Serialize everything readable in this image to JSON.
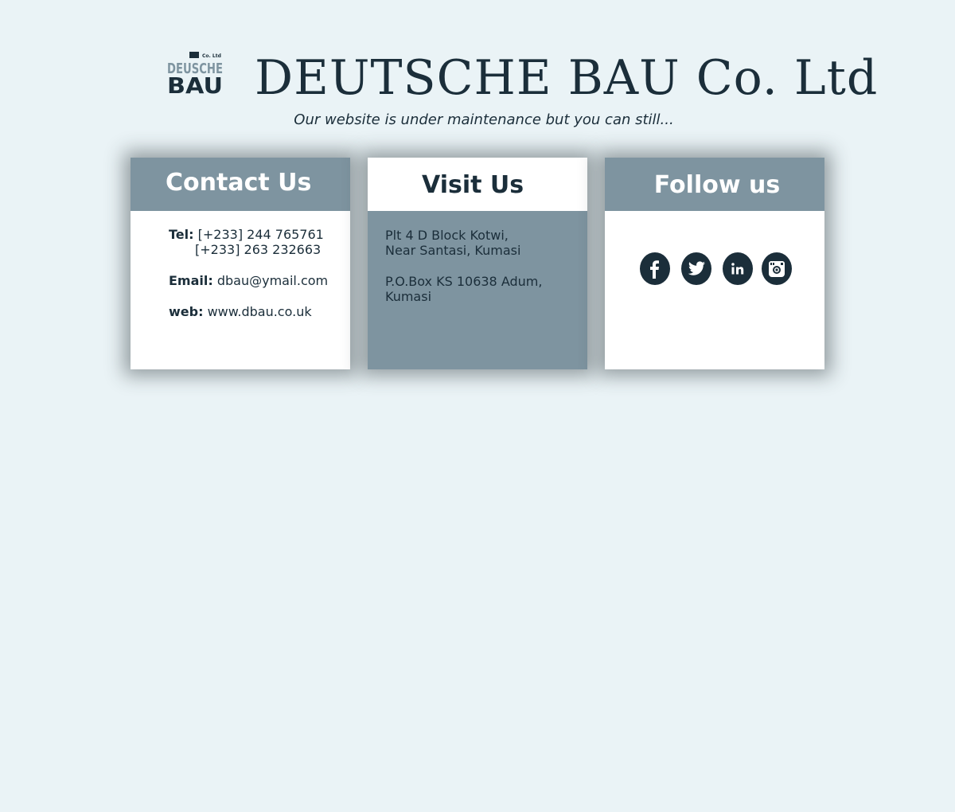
{
  "header": {
    "logo_text": "DEUSCHE BAU Co. Ltd",
    "title": "DEUTSCHE BAU Co. Ltd",
    "tagline": "Our website is under maintenance but you can still..."
  },
  "contact": {
    "heading": "Contact Us",
    "tel_label": "Tel:",
    "tel_1": "[+233] 244 765761",
    "tel_2": "[+233] 263 232663",
    "email_label": "Email:",
    "email": "dbau@ymail.com",
    "web_label": "web:",
    "web": "www.dbau.co.uk"
  },
  "visit": {
    "heading": "Visit Us",
    "address_line_1": "Plt 4 D Block Kotwi,",
    "address_line_2": "Near Santasi, Kumasi",
    "pobox_line_1": "P.O.Box KS 10638 Adum,",
    "pobox_line_2": "Kumasi"
  },
  "follow": {
    "heading": "Follow us",
    "icons": [
      "facebook-icon",
      "twitter-icon",
      "linkedin-icon",
      "instagram-icon"
    ]
  },
  "colors": {
    "background": "#eaf3f6",
    "dark": "#1b2e3a",
    "slate": "#7e94a0",
    "white": "#ffffff"
  }
}
